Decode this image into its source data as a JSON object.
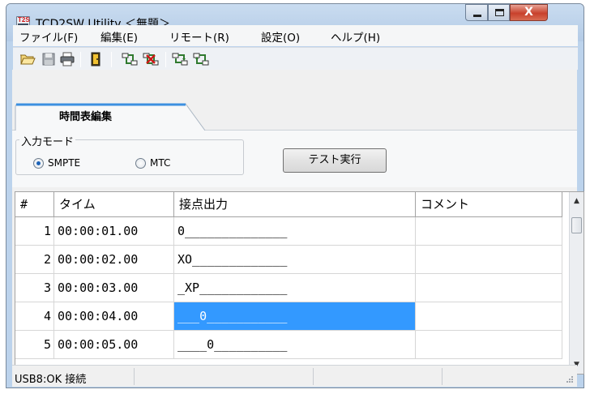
{
  "window": {
    "title": "TCD2SW Utility ＜無題＞",
    "icon": "t2s-app-icon",
    "controls": {
      "minimize": "minimize-icon",
      "maximize": "maximize-icon",
      "close": "close-icon",
      "close_glyph": "X"
    }
  },
  "menu": {
    "items": [
      "ファイル(F)",
      "編集(E)",
      "リモート(R)",
      "設定(O)",
      "ヘルプ(H)"
    ]
  },
  "toolbar": {
    "icons": [
      "open-folder-icon",
      "save-icon",
      "print-icon",
      "exit-icon",
      "connect-icon",
      "disconnect-icon",
      "upload-icon",
      "download-icon"
    ]
  },
  "tabs": [
    {
      "label": "時間表編集",
      "active": true
    }
  ],
  "input_mode": {
    "group_label": "入力モード",
    "options": [
      {
        "label": "SMPTE",
        "checked": true
      },
      {
        "label": "MTC",
        "checked": false
      }
    ]
  },
  "test_button": {
    "label": "テスト実行"
  },
  "grid": {
    "columns": [
      "#",
      "タイム",
      "接点出力",
      "コメント"
    ],
    "rows": [
      {
        "num": "1",
        "time": "00:00:01.00",
        "output": "0______________",
        "comment": "",
        "selected": false
      },
      {
        "num": "2",
        "time": "00:00:02.00",
        "output": "XO_____________",
        "comment": "",
        "selected": false
      },
      {
        "num": "3",
        "time": "00:00:03.00",
        "output": "_XP____________",
        "comment": "",
        "selected": false
      },
      {
        "num": "4",
        "time": "00:00:04.00",
        "output": "___0___________",
        "comment": "",
        "selected": true
      },
      {
        "num": "5",
        "time": "00:00:05.00",
        "output": "____0__________",
        "comment": "",
        "selected": false
      }
    ]
  },
  "status": {
    "text": "USB8:OK 接続"
  },
  "colors": {
    "selection": "#3399ff",
    "titlebar": "#b9cfe8",
    "close_button": "#c8412c"
  }
}
